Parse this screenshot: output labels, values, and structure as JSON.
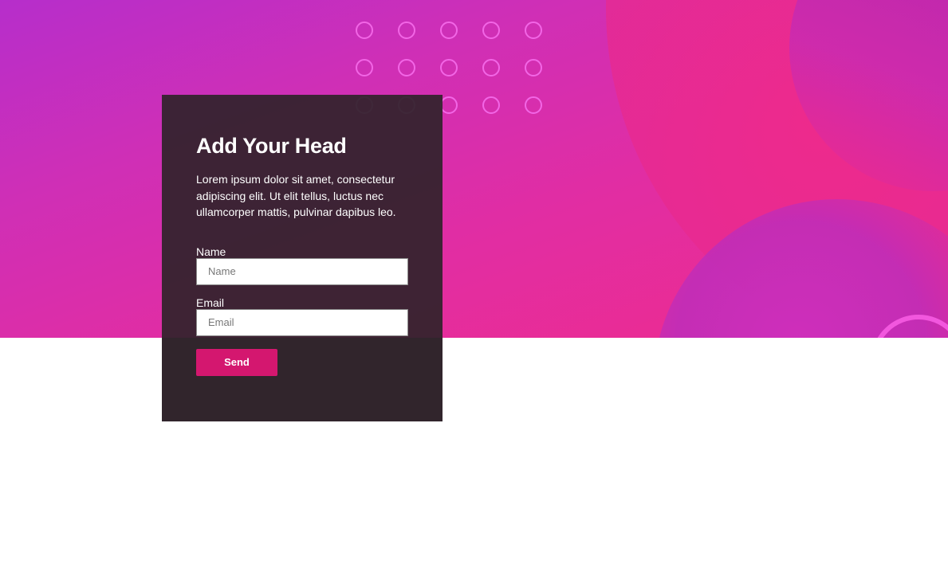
{
  "hero": {
    "accent_colors": [
      "#b62ecb",
      "#e12da3",
      "#ef2c8c",
      "#f266e6"
    ]
  },
  "form_card": {
    "title": "Add Your Head",
    "description": "Lorem ipsum dolor sit amet, consectetur adipiscing elit. Ut elit tellus, luctus nec ullamcorper mattis, pulvinar dapibus leo.",
    "name_label": "Name",
    "name_placeholder": "Name",
    "email_label": "Email",
    "email_placeholder": "Email",
    "send_label": "Send",
    "button_color": "#d4176f"
  }
}
